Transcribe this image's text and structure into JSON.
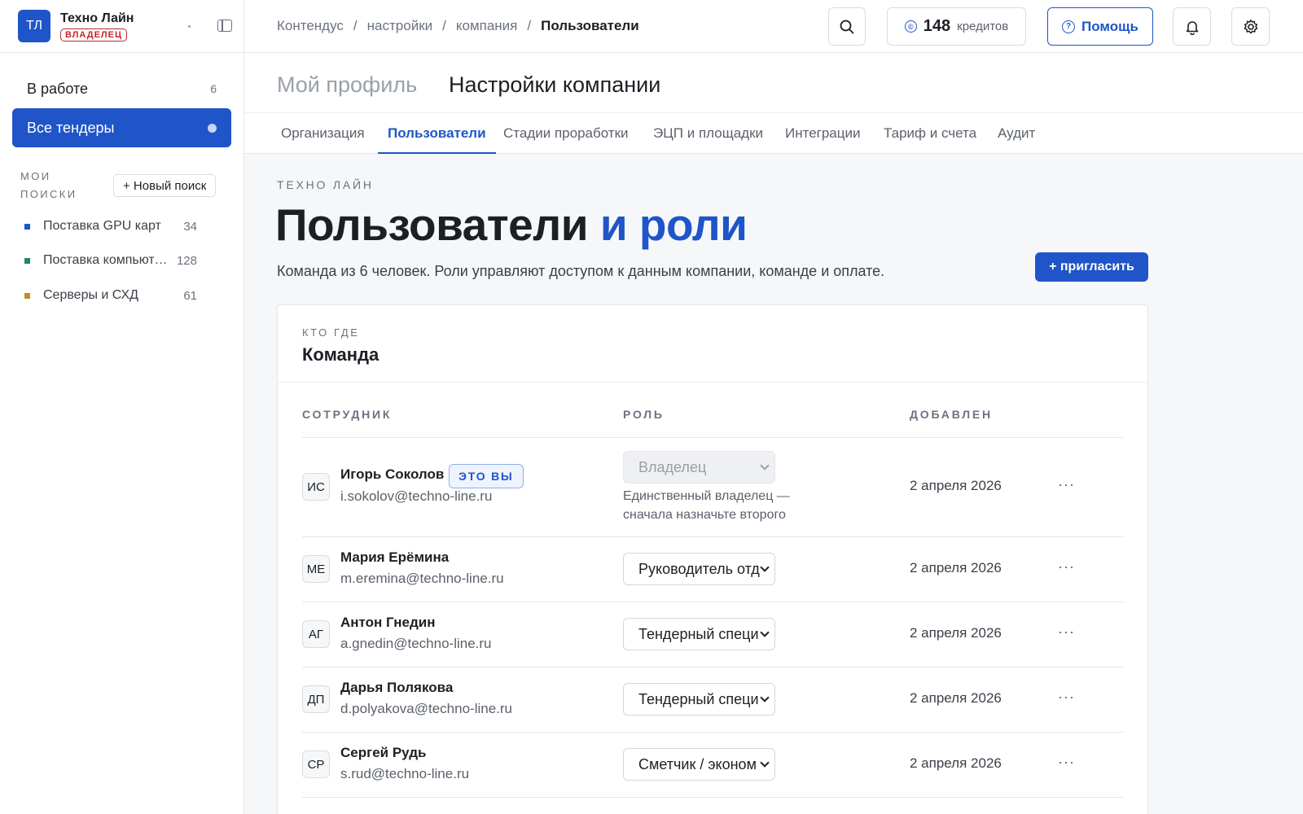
{
  "org": {
    "initials": "ТЛ",
    "name": "Техно Лайн",
    "role_badge": "ВЛАДЕЛЕЦ"
  },
  "nav": {
    "in_work": {
      "label": "В работе",
      "count": "6"
    },
    "all_tenders": {
      "label": "Все тендеры"
    }
  },
  "searches": {
    "title": "МОИ ПОИСКИ",
    "new_label": "+ Новый поиск",
    "items": [
      {
        "name": "Поставка GPU карт",
        "count": "34",
        "color": "#1f55c8"
      },
      {
        "name": "Поставка компьютеров",
        "count": "128",
        "color": "#1f8a5b"
      },
      {
        "name": "Серверы и СХД",
        "count": "61",
        "color": "#c98a2b"
      }
    ]
  },
  "breadcrumb": [
    "Контендус",
    "настройки",
    "компания",
    "Пользователи"
  ],
  "topbar": {
    "credits_value": "148",
    "credits_label": "кредитов",
    "help_label": "Помощь"
  },
  "page_tabs": {
    "profile": "Мой профиль",
    "company": "Настройки компании"
  },
  "subtabs": [
    "Организация",
    "Пользователи",
    "Стадии проработки",
    "ЭЦП и площадки",
    "Интеграции",
    "Тариф и счета",
    "Аудит"
  ],
  "main": {
    "eyebrow": "ТЕХНО ЛАЙН",
    "title_main": "Пользователи",
    "title_accent": "и роли",
    "lead": "Команда из 6 человек. Роли управляют доступом к данным компании, команде и оплате.",
    "invite_label": "+ пригласить"
  },
  "team": {
    "eyebrow": "КТО ГДЕ",
    "title": "Команда",
    "headers": {
      "employee": "СОТРУДНИК",
      "role": "РОЛЬ",
      "added": "ДОБАВЛЕН"
    },
    "rows": [
      {
        "initials": "ИС",
        "name": "Игорь Соколов",
        "email": "i.sokolov@techno-line.ru",
        "badge": "ЭТО ВЫ",
        "role": "Владелец",
        "note": "Единственный владелец — сначала назначьте второго",
        "added": "2 апреля 2026",
        "more": "···"
      },
      {
        "initials": "МЕ",
        "name": "Мария Ерёмина",
        "email": "m.eremina@techno-line.ru",
        "role": "Руководитель отд",
        "added": "2 апреля 2026",
        "more": "···"
      },
      {
        "initials": "АГ",
        "name": "Антон Гнедин",
        "email": "a.gnedin@techno-line.ru",
        "role": "Тендерный специ",
        "added": "2 апреля 2026",
        "more": "···"
      },
      {
        "initials": "ДП",
        "name": "Дарья Полякова",
        "email": "d.polyakova@techno-line.ru",
        "role": "Тендерный специ",
        "added": "2 апреля 2026",
        "more": "···"
      },
      {
        "initials": "СР",
        "name": "Сергей Рудь",
        "email": "s.rud@techno-line.ru",
        "role": "Сметчик / эконом",
        "added": "2 апреля 2026",
        "more": "···"
      }
    ]
  }
}
